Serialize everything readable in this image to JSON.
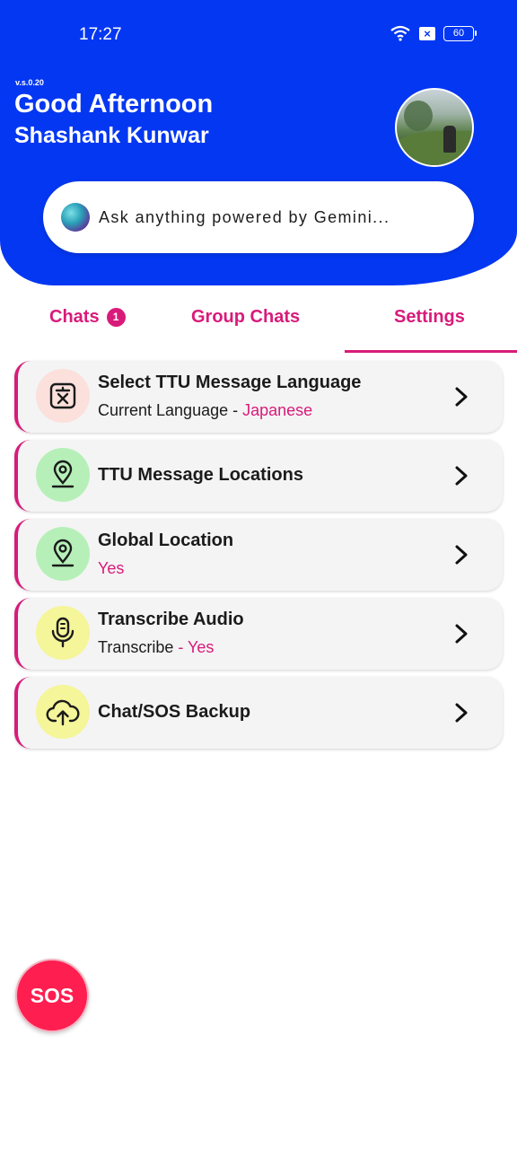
{
  "status_bar": {
    "time": "17:27",
    "sim_label": "×",
    "battery": "60"
  },
  "header": {
    "version": "v.s.0.20",
    "greeting": "Good Afternoon",
    "username": "Shashank Kunwar"
  },
  "search": {
    "placeholder": "Ask anything powered by Gemini..."
  },
  "tabs": [
    {
      "label": "Chats",
      "badge": "1"
    },
    {
      "label": "Group Chats"
    },
    {
      "label": "Settings",
      "active": true
    }
  ],
  "settings": [
    {
      "title": "Select TTU Message Language",
      "subtitle_prefix": "Current Language - ",
      "subtitle_value": "Japanese",
      "icon": "translate-icon"
    },
    {
      "title": "TTU Message Locations",
      "icon": "location-pin-icon"
    },
    {
      "title": "Global Location",
      "subtitle_value": "Yes",
      "icon": "location-pin-icon"
    },
    {
      "title": "Transcribe Audio",
      "subtitle_prefix": "Transcribe ",
      "subtitle_value": "- Yes",
      "icon": "microphone-icon"
    },
    {
      "title": "Chat/SOS Backup",
      "icon": "cloud-upload-icon"
    }
  ],
  "sos_label": "SOS",
  "colors": {
    "header_blue": "#0437f2",
    "accent_pink": "#d81b7a",
    "sos_red": "#ff1e50"
  }
}
